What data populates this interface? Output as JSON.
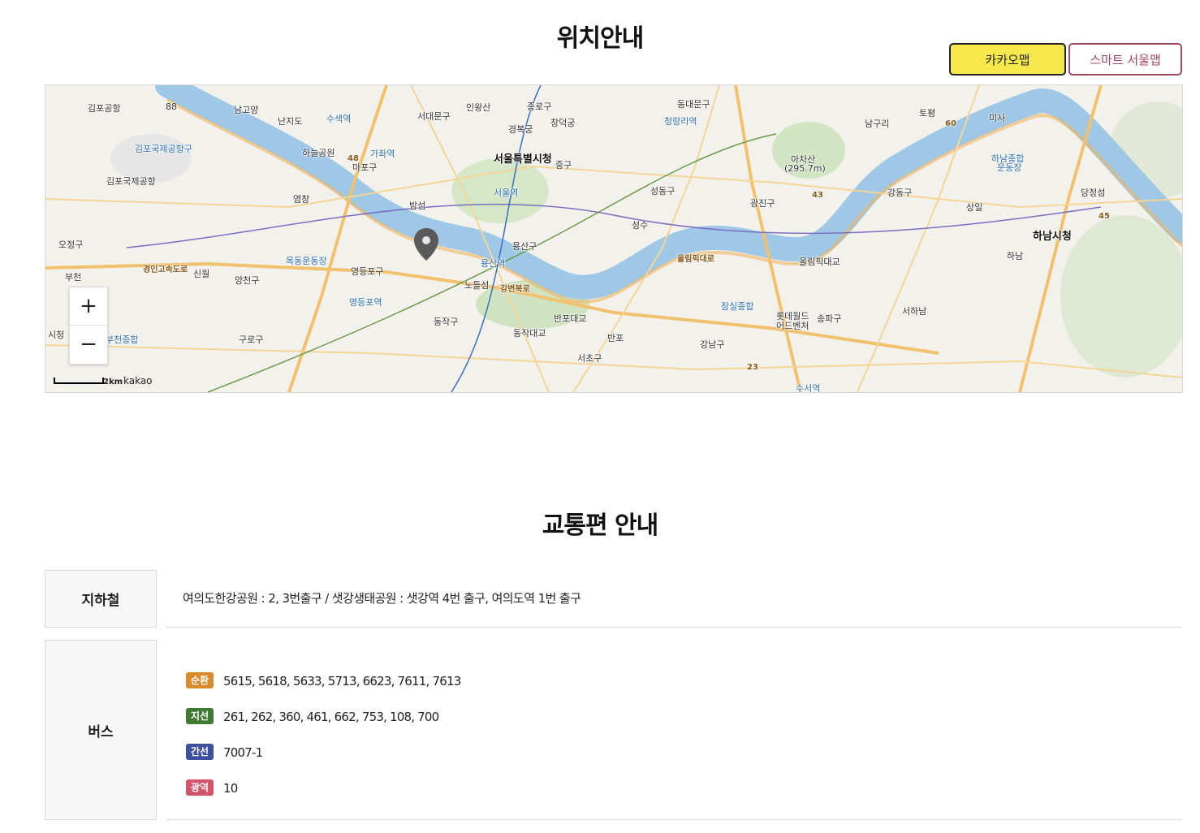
{
  "sections": {
    "location_title": "위치안내",
    "transport_title": "교통편 안내"
  },
  "map_buttons": {
    "kakao": "카카오맵",
    "seoul": "스마트 서울맵"
  },
  "map": {
    "zoom_in": "+",
    "zoom_out": "−",
    "scale": "2km",
    "attribution": "kakao",
    "labels": [
      "김포공항",
      "88",
      "남고양",
      "난지도",
      "수색역",
      "서대문구",
      "인왕산",
      "종로구",
      "경복궁",
      "창덕궁",
      "동대문구",
      "청량리역",
      "김포국제공항구",
      "김포국제공항",
      "하늘공원",
      "가좌역",
      "48",
      "마포구",
      "서울특별시청",
      "중구",
      "서울역",
      "아차산",
      "(295.7m)",
      "성동구",
      "광진구",
      "43",
      "남구리",
      "토평",
      "60",
      "미사",
      "하남종합",
      "운동장",
      "강동구",
      "상일",
      "당정섬",
      "45",
      "하남시청",
      "오정구",
      "염창",
      "밤섬",
      "용산구",
      "용산역",
      "성수",
      "목동운동장",
      "경인고속도로",
      "신월",
      "양천구",
      "영등포구",
      "노들섬",
      "강변북로",
      "올림픽대로",
      "부천",
      "영등포역",
      "반포대교",
      "잠실종합",
      "롯데월드",
      "어드벤처",
      "송파구",
      "서하남",
      "하남",
      "시청",
      "부천종합",
      "동작구",
      "동작대교",
      "반포",
      "구로구",
      "서초구",
      "강남구",
      "23",
      "수서역",
      "올림픽대교"
    ]
  },
  "transport": {
    "subway_label": "지하철",
    "subway_text": "여의도한강공원 : 2, 3번출구 / 샛강생태공원 : 샛강역 4번 출구, 여의도역 1번 출구",
    "bus_label": "버스",
    "bus_lines": [
      {
        "type": "순환",
        "color": "#d98a2b",
        "numbers": "5615, 5618, 5633, 5713, 6623, 7611, 7613"
      },
      {
        "type": "지선",
        "color": "#3f7a32",
        "numbers": "261, 262, 360, 461, 662, 753, 108, 700"
      },
      {
        "type": "간선",
        "color": "#3f4fa0",
        "numbers": "7007-1"
      },
      {
        "type": "광역",
        "color": "#d2536a",
        "numbers": "10"
      }
    ]
  }
}
